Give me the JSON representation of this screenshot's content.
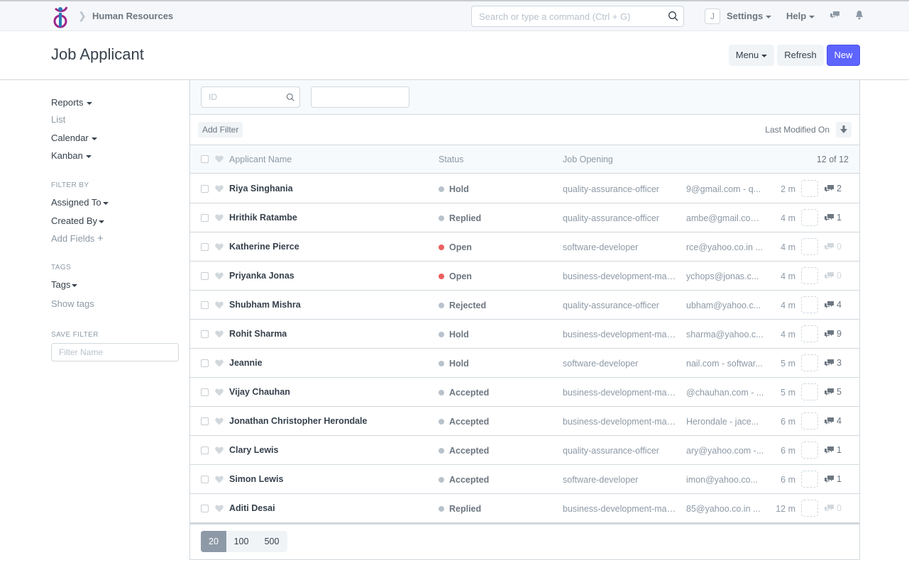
{
  "navbar": {
    "breadcrumb": "Human Resources",
    "search_placeholder": "Search or type a command (Ctrl + G)",
    "avatar_initial": "J",
    "settings_label": "Settings",
    "help_label": "Help"
  },
  "page": {
    "title": "Job Applicant",
    "menu_label": "Menu",
    "refresh_label": "Refresh",
    "new_label": "New",
    "primary_color": "#5e64ff"
  },
  "sidebar": {
    "reports": "Reports",
    "list": "List",
    "calendar": "Calendar",
    "kanban": "Kanban",
    "filter_by_heading": "FILTER BY",
    "assigned_to": "Assigned To",
    "created_by": "Created By",
    "add_fields": "Add Fields",
    "tags_heading": "TAGS",
    "tags": "Tags",
    "show_tags": "Show tags",
    "save_filter_heading": "SAVE FILTER",
    "filter_name_placeholder": "Filter Name"
  },
  "filters": {
    "id_placeholder": "ID",
    "second_value": "",
    "add_filter": "Add Filter",
    "sort_label": "Last Modified On"
  },
  "list": {
    "columns": {
      "name": "Applicant Name",
      "status": "Status",
      "job": "Job Opening",
      "count": "12 of 12"
    },
    "status_colors": {
      "Open": "#ec5f5f",
      "default": "#b8c2cc"
    },
    "rows": [
      {
        "name": "Riya Singhania",
        "status": "Hold",
        "job": "quality-assurance-officer",
        "extra": "9@gmail.com - q...",
        "modified": "2 m",
        "comments": "2"
      },
      {
        "name": "Hrithik Ratambe",
        "status": "Replied",
        "job": "quality-assurance-officer",
        "extra": "ambe@gmail.com...",
        "modified": "4 m",
        "comments": "1"
      },
      {
        "name": "Katherine Pierce",
        "status": "Open",
        "job": "software-developer",
        "extra": "rce@yahoo.co.in ...",
        "modified": "4 m",
        "comments": "0"
      },
      {
        "name": "Priyanka Jonas",
        "status": "Open",
        "job": "business-development-ma…",
        "extra": "ychops@jonas.c...",
        "modified": "4 m",
        "comments": "0"
      },
      {
        "name": "Shubham Mishra",
        "status": "Rejected",
        "job": "quality-assurance-officer",
        "extra": "ubham@yahoo.c...",
        "modified": "4 m",
        "comments": "4"
      },
      {
        "name": "Rohit Sharma",
        "status": "Hold",
        "job": "business-development-ma…",
        "extra": "sharma@yahoo.c...",
        "modified": "4 m",
        "comments": "9"
      },
      {
        "name": "Jeannie",
        "status": "Hold",
        "job": "software-developer",
        "extra": "nail.com - softwar...",
        "modified": "5 m",
        "comments": "3"
      },
      {
        "name": "Vijay Chauhan",
        "status": "Accepted",
        "job": "business-development-ma…",
        "extra": "@chauhan.com - ...",
        "modified": "5 m",
        "comments": "5"
      },
      {
        "name": "Jonathan Christopher Herondale",
        "status": "Accepted",
        "job": "business-development-ma…",
        "extra": "Herondale - jace...",
        "modified": "6 m",
        "comments": "4"
      },
      {
        "name": "Clary Lewis",
        "status": "Accepted",
        "job": "quality-assurance-officer",
        "extra": "ary@yahoo.com -...",
        "modified": "6 m",
        "comments": "1"
      },
      {
        "name": "Simon Lewis",
        "status": "Accepted",
        "job": "software-developer",
        "extra": "imon@yahoo.co...",
        "modified": "6 m",
        "comments": "1"
      },
      {
        "name": "Aditi Desai",
        "status": "Replied",
        "job": "business-development-ma…",
        "extra": "85@yahoo.co.in ...",
        "modified": "12 m",
        "comments": "0"
      }
    ]
  },
  "paging": {
    "options": [
      "20",
      "100",
      "500"
    ],
    "selected": "20"
  }
}
